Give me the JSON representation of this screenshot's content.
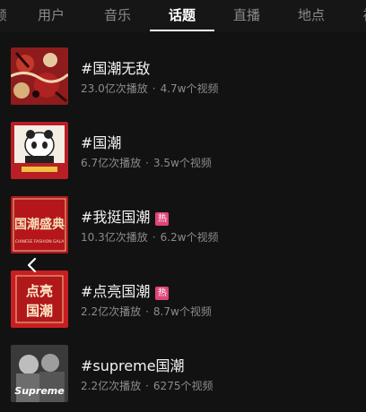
{
  "tabs": [
    {
      "label": "频"
    },
    {
      "label": "用户"
    },
    {
      "label": "音乐"
    },
    {
      "label": "话题",
      "active": true
    },
    {
      "label": "直播"
    },
    {
      "label": "地点"
    },
    {
      "label": "视"
    }
  ],
  "hot_badge": "热",
  "topics": [
    {
      "title": "#国潮无敌",
      "plays": "23.0亿次播放",
      "videos": "4.7w个视频",
      "hot": false
    },
    {
      "title": "#国潮",
      "plays": "6.7亿次播放",
      "videos": "3.5w个视频",
      "hot": false
    },
    {
      "title": "#我挺国潮",
      "plays": "10.3亿次播放",
      "videos": "6.2w个视频",
      "hot": true
    },
    {
      "title": "#点亮国潮",
      "plays": "2.2亿次播放",
      "videos": "8.7w个视频",
      "hot": true
    },
    {
      "title": "#supreme国潮",
      "plays": "2.2亿次播放",
      "videos": "6275个视频",
      "hot": false
    }
  ],
  "thumb_text": {
    "t3_main": "国潮盛典",
    "t3_sub": "CHINESE FASHION GALA",
    "t4_line1": "点亮",
    "t4_line2": "国潮",
    "t5_brand": "Supreme"
  },
  "meta_separator": "·",
  "colors": {
    "background": "#121212",
    "active_tab": "#ffffff",
    "inactive_tab": "#8a8a8a",
    "hot_badge": "#e0457b",
    "meta_text": "#8b8b8b"
  }
}
